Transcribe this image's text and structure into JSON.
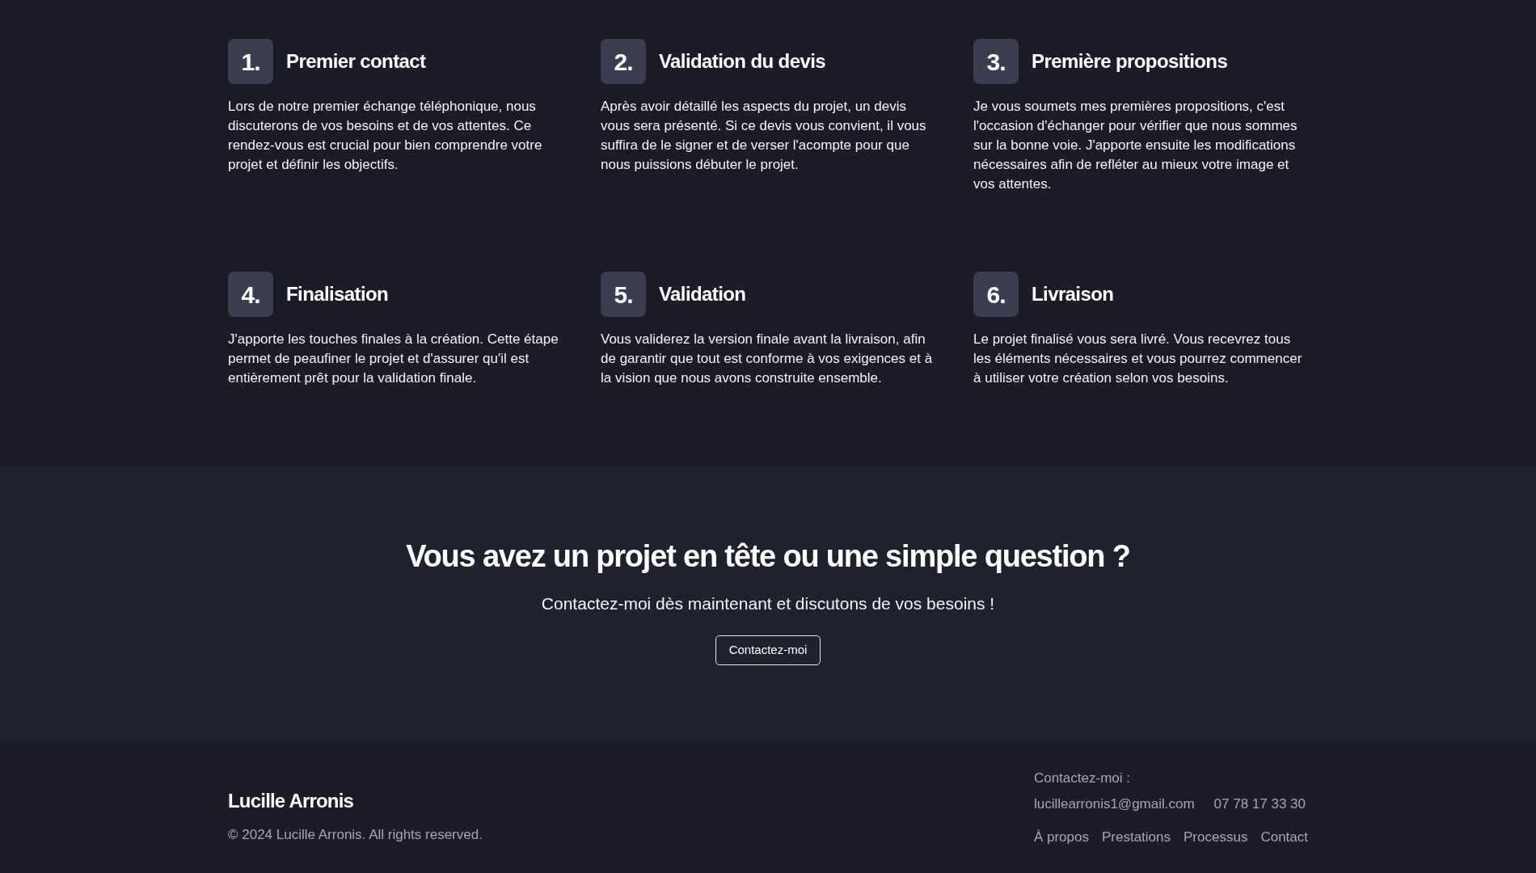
{
  "steps": [
    {
      "number": "1.",
      "title": "Premier contact",
      "description": "Lors de notre premier échange téléphonique, nous discuterons de vos besoins et de vos attentes. Ce rendez-vous est crucial pour bien comprendre votre projet et définir les objectifs."
    },
    {
      "number": "2.",
      "title": "Validation du devis",
      "description": "Après avoir détaillé les aspects du projet, un devis vous sera présenté. Si ce devis vous convient, il vous suffira de le signer et de verser l'acompte pour que nous puissions débuter le projet."
    },
    {
      "number": "3.",
      "title": "Première propositions",
      "description": "Je vous soumets mes premières propositions, c'est l'occasion d'échanger pour vérifier que nous sommes sur la bonne voie. J'apporte ensuite les modifications nécessaires afin de refléter au mieux votre image et vos attentes."
    },
    {
      "number": "4.",
      "title": "Finalisation",
      "description": "J'apporte les touches finales à la création. Cette étape permet de peaufiner le projet et d'assurer qu'il est entièrement prêt pour la validation finale."
    },
    {
      "number": "5.",
      "title": "Validation",
      "description": "Vous validerez la version finale avant la livraison, afin de garantir que tout est conforme à vos exigences et à la vision que nous avons construite ensemble."
    },
    {
      "number": "6.",
      "title": "Livraison",
      "description": "Le projet finalisé vous sera livré. Vous recevrez tous les éléments nécessaires et vous pourrez commencer à utiliser votre création selon vos besoins."
    }
  ],
  "cta": {
    "heading": "Vous avez un projet en tête ou une simple question ?",
    "subtitle": "Contactez-moi dès maintenant et discutons de vos besoins !",
    "button": "Contactez-moi"
  },
  "footer": {
    "brand": "Lucille Arronis",
    "copyright": "© 2024 Lucille Arronis. All rights reserved.",
    "contact_label": "Contactez-moi :",
    "email": "lucillearronis1@gmail.com",
    "phone": "07 78 17 33 30",
    "links": [
      "À propos",
      "Prestations",
      "Processus",
      "Contact"
    ]
  }
}
